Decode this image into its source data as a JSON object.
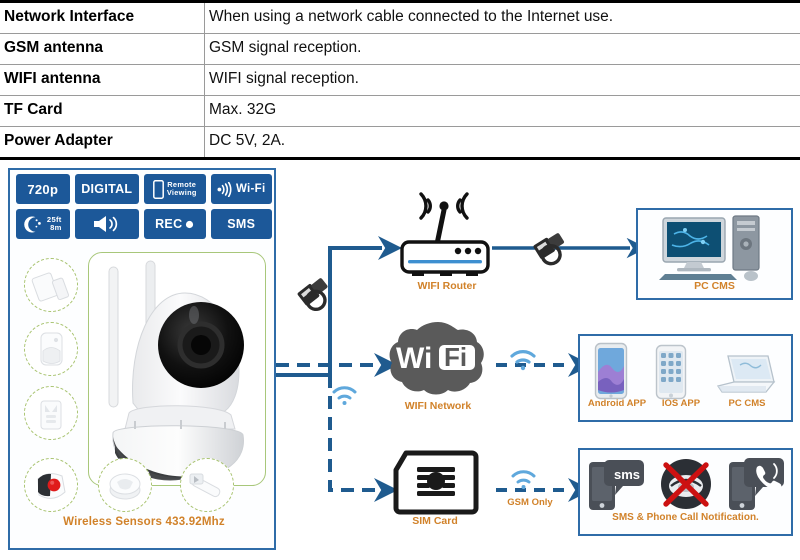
{
  "spec_table": {
    "rows": [
      {
        "label": "Network Interface",
        "value": "When using a network cable connected to the Internet use."
      },
      {
        "label": "GSM antenna",
        "value": "GSM signal reception."
      },
      {
        "label": "WIFI antenna",
        "value": "WIFI signal reception."
      },
      {
        "label": "TF Card",
        "value": "Max. 32G"
      },
      {
        "label": "Power Adapter",
        "value": "DC 5V, 2A."
      }
    ]
  },
  "diagram": {
    "badges": [
      {
        "id": "resolution",
        "label": "720p"
      },
      {
        "id": "digital",
        "label": "DIGITAL"
      },
      {
        "id": "remote-viewing",
        "label_line1": "Remote",
        "label_line2": "Viewing",
        "icon": "phone-icon"
      },
      {
        "id": "wifi",
        "label": "Wi-Fi",
        "icon": "wifi-signal-icon"
      },
      {
        "id": "night-vision",
        "label_line1": "25ft",
        "label_line2": "8m",
        "icon": "moon-stars-icon"
      },
      {
        "id": "audio",
        "label": "",
        "icon": "speaker-icon"
      },
      {
        "id": "recording",
        "label": "REC"
      },
      {
        "id": "sms",
        "label": "SMS"
      }
    ],
    "camera_panel": {
      "device_name": "ip-camera",
      "sensors_label": "Wireless Sensors  433.92Mhz",
      "sensors": [
        {
          "id": "door-window-sensor"
        },
        {
          "id": "pir-motion-sensor"
        },
        {
          "id": "remote-control-sensor"
        },
        {
          "id": "panic-button-sensor"
        },
        {
          "id": "smoke-detector-sensor"
        },
        {
          "id": "gas-detector-sensor"
        }
      ]
    },
    "nodes": {
      "router_label": "WIFI Router",
      "wifi_network_label": "WIFI Network",
      "sim_card_label": "SIM Card",
      "gsm_only_label": "GSM Only",
      "pc_cms_label": "PC CMS"
    },
    "app_box": {
      "items": [
        {
          "id": "android-app",
          "label": "Android APP"
        },
        {
          "id": "ios-app",
          "label": "IOS APP"
        },
        {
          "id": "pc-cms",
          "label": "PC CMS"
        }
      ]
    },
    "sms_box": {
      "label": "SMS & Phone Call Notification.",
      "sms_bubble_text": "sms"
    },
    "colors": {
      "badge_blue": "#1c5899",
      "line_blue": "#1f5b8f",
      "box_border": "#2f6ca8",
      "caption_orange": "#d1822a",
      "sensor_green": "#a9c471",
      "wifi_arc": "#5fa8dc",
      "wifi_logo_gray": "#5a5a5a",
      "cross_red": "#cc1111"
    }
  }
}
